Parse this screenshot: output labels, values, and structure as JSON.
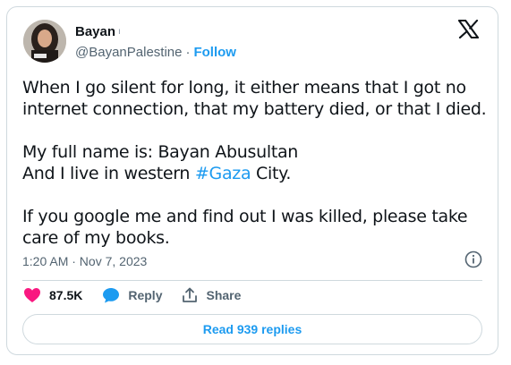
{
  "author": {
    "name": "Bayan",
    "handle": "@BayanPalestine",
    "separator": "·",
    "follow_label": "Follow"
  },
  "tweet": {
    "line1": "When I go silent for long, it either means that I got no internet connection, that my battery died, or that I died.",
    "line2": "My full name is: Bayan Abusultan",
    "line3_prefix": "And I live in western ",
    "hashtag": "#Gaza",
    "line3_suffix": " City.",
    "line4": "If you google me and find out I was killed, please take care of my books."
  },
  "timestamp": "1:20 AM · Nov 7, 2023",
  "actions": {
    "like_count": "87.5K",
    "reply_label": "Reply",
    "share_label": "Share"
  },
  "read_replies_label": "Read 939 replies",
  "colors": {
    "accent": "#1d9bf0",
    "like": "#f91880",
    "text": "#0f1419",
    "muted": "#536471",
    "border": "#cfd9de"
  },
  "icons": [
    "x-logo-icon",
    "verified-icon",
    "info-icon",
    "heart-icon",
    "reply-bubble-icon",
    "share-icon"
  ]
}
